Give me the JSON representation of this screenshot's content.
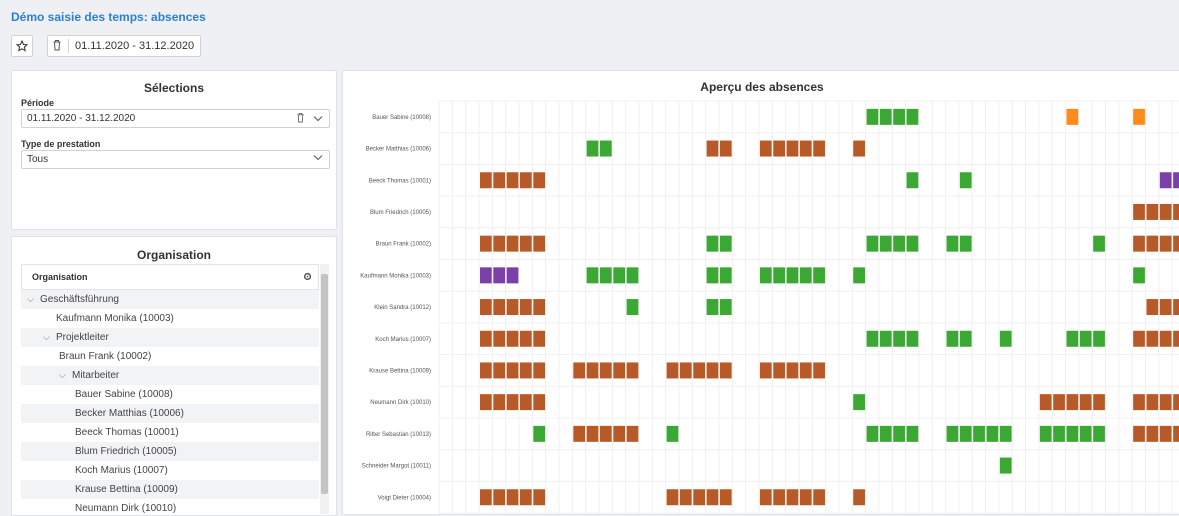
{
  "app": {
    "title": "Démo saisie des temps: absences"
  },
  "toolbar": {
    "star_icon": "star-icon",
    "trash_icon": "trash-icon",
    "date_range": "01.11.2020 - 31.12.2020"
  },
  "selections": {
    "title": "Sélections",
    "periode_label": "Période",
    "periode_value": "01.11.2020 - 31.12.2020",
    "type_label": "Type de prestation",
    "type_value": "Tous"
  },
  "organisation": {
    "title": "Organisation",
    "column_header": "Organisation",
    "items": [
      {
        "label": "Geschäftsführung",
        "expanded": true
      },
      {
        "label": "Kaufmann Monika (10003)"
      },
      {
        "label": "Projektleiter",
        "expanded": true
      },
      {
        "label": "Braun Frank (10002)"
      },
      {
        "label": "Mitarbeiter",
        "expanded": true
      },
      {
        "label": "Bauer Sabine (10008)"
      },
      {
        "label": "Becker Matthias (10006)"
      },
      {
        "label": "Beeck Thomas (10001)"
      },
      {
        "label": "Blum Friedrich (10005)"
      },
      {
        "label": "Koch Marius (10007)"
      },
      {
        "label": "Krause Bettina (10009)"
      },
      {
        "label": "Neumann Dirk (10010)"
      }
    ]
  },
  "chart": {
    "title": "Aperçu des absences"
  },
  "colors": {
    "green": "#3aa832",
    "brown": "#b85a28",
    "purple": "#7a3fa8",
    "orange": "#ff8c1a"
  },
  "chart_data": {
    "type": "heatmap",
    "title": "Aperçu des absences",
    "employees": [
      "Bauer Sabine (10008)",
      "Becker Matthias (10006)",
      "Beeck Thomas (10001)",
      "Blum Friedrich (10005)",
      "Braun Frank (10002)",
      "Kaufmann Monika (10003)",
      "Klein Sandra (10012)",
      "Koch Marius (10007)",
      "Krause Bettina (10009)",
      "Neumann Dirk (10010)",
      "Ritter Sebastian (10013)",
      "Schneider Margot (10011)",
      "Voigt Dieter (10004)"
    ],
    "absences": [
      [
        [
          32,
          4,
          "green"
        ],
        [
          47,
          1,
          "orange"
        ],
        [
          52,
          1,
          "orange"
        ]
      ],
      [
        [
          11,
          2,
          "green"
        ],
        [
          20,
          2,
          "brown"
        ],
        [
          24,
          5,
          "brown"
        ],
        [
          31,
          1,
          "brown"
        ]
      ],
      [
        [
          3,
          5,
          "brown"
        ],
        [
          35,
          1,
          "green"
        ],
        [
          39,
          1,
          "green"
        ],
        [
          54,
          2,
          "purple"
        ]
      ],
      [
        [
          52,
          4,
          "brown"
        ]
      ],
      [
        [
          3,
          5,
          "brown"
        ],
        [
          20,
          2,
          "green"
        ],
        [
          32,
          4,
          "green"
        ],
        [
          38,
          2,
          "green"
        ],
        [
          49,
          1,
          "green"
        ],
        [
          52,
          4,
          "brown"
        ]
      ],
      [
        [
          3,
          3,
          "purple"
        ],
        [
          11,
          4,
          "green"
        ],
        [
          20,
          2,
          "green"
        ],
        [
          24,
          5,
          "green"
        ],
        [
          31,
          1,
          "green"
        ],
        [
          52,
          1,
          "green"
        ]
      ],
      [
        [
          3,
          5,
          "brown"
        ],
        [
          14,
          1,
          "green"
        ],
        [
          20,
          2,
          "green"
        ],
        [
          53,
          3,
          "brown"
        ]
      ],
      [
        [
          3,
          5,
          "brown"
        ],
        [
          32,
          4,
          "green"
        ],
        [
          38,
          2,
          "green"
        ],
        [
          42,
          1,
          "green"
        ],
        [
          47,
          3,
          "green"
        ],
        [
          52,
          4,
          "brown"
        ]
      ],
      [
        [
          3,
          5,
          "brown"
        ],
        [
          10,
          5,
          "brown"
        ],
        [
          17,
          5,
          "brown"
        ],
        [
          24,
          5,
          "brown"
        ]
      ],
      [
        [
          3,
          5,
          "brown"
        ],
        [
          31,
          1,
          "green"
        ],
        [
          45,
          5,
          "brown"
        ],
        [
          52,
          4,
          "brown"
        ]
      ],
      [
        [
          7,
          1,
          "green"
        ],
        [
          10,
          5,
          "brown"
        ],
        [
          17,
          1,
          "green"
        ],
        [
          32,
          4,
          "green"
        ],
        [
          38,
          5,
          "green"
        ],
        [
          45,
          5,
          "green"
        ],
        [
          52,
          4,
          "brown"
        ]
      ],
      [
        [
          42,
          1,
          "green"
        ]
      ],
      [
        [
          3,
          5,
          "brown"
        ],
        [
          17,
          5,
          "brown"
        ],
        [
          24,
          5,
          "brown"
        ],
        [
          31,
          1,
          "brown"
        ]
      ]
    ]
  }
}
